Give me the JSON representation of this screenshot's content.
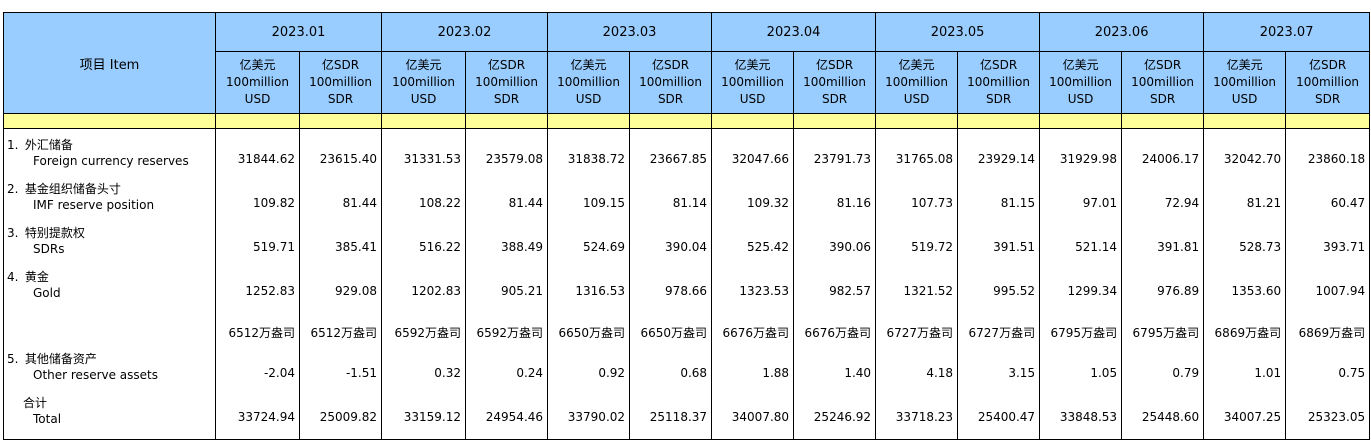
{
  "header": {
    "item_label": "项目 Item",
    "periods": [
      "2023.01",
      "2023.02",
      "2023.03",
      "2023.04",
      "2023.05",
      "2023.06",
      "2023.07"
    ],
    "units": {
      "usd": {
        "zh": "亿美元",
        "en1": "100million",
        "en2": "USD"
      },
      "sdr": {
        "zh": "亿SDR",
        "en1": "100million",
        "en2": "SDR"
      }
    }
  },
  "rows": [
    {
      "num": "1.",
      "zh": "外汇储备",
      "en": "Foreign currency reserves",
      "values": [
        "31844.62",
        "23615.40",
        "31331.53",
        "23579.08",
        "31838.72",
        "23667.85",
        "32047.66",
        "23791.73",
        "31765.08",
        "23929.14",
        "31929.98",
        "24006.17",
        "32042.70",
        "23860.18"
      ]
    },
    {
      "num": "2.",
      "zh": "基金组织储备头寸",
      "en": "IMF reserve position",
      "values": [
        "109.82",
        "81.44",
        "108.22",
        "81.44",
        "109.15",
        "81.14",
        "109.32",
        "81.16",
        "107.73",
        "81.15",
        "97.01",
        "72.94",
        "81.21",
        "60.47"
      ]
    },
    {
      "num": "3.",
      "zh": "特别提款权",
      "en": "SDRs",
      "values": [
        "519.71",
        "385.41",
        "516.22",
        "388.49",
        "524.69",
        "390.04",
        "525.42",
        "390.06",
        "519.72",
        "391.51",
        "521.14",
        "391.81",
        "528.73",
        "393.71"
      ]
    },
    {
      "num": "4.",
      "zh": "黄金",
      "en": "Gold",
      "values": [
        "1252.83",
        "929.08",
        "1202.83",
        "905.21",
        "1316.53",
        "978.66",
        "1323.53",
        "982.57",
        "1321.52",
        "995.52",
        "1299.34",
        "976.89",
        "1353.60",
        "1007.94"
      ]
    }
  ],
  "gold_ounces": [
    "6512万盎司",
    "6512万盎司",
    "6592万盎司",
    "6592万盎司",
    "6650万盎司",
    "6650万盎司",
    "6676万盎司",
    "6676万盎司",
    "6727万盎司",
    "6727万盎司",
    "6795万盎司",
    "6795万盎司",
    "6869万盎司",
    "6869万盎司"
  ],
  "other": {
    "num": "5.",
    "zh": "其他储备资产",
    "en": "Other reserve assets",
    "values": [
      "-2.04",
      "-1.51",
      "0.32",
      "0.24",
      "0.92",
      "0.68",
      "1.88",
      "1.40",
      "4.18",
      "3.15",
      "1.05",
      "0.79",
      "1.01",
      "0.75"
    ]
  },
  "total": {
    "zh": "合计",
    "en": "Total",
    "values": [
      "33724.94",
      "25009.82",
      "33159.12",
      "24954.46",
      "33790.02",
      "25118.37",
      "34007.80",
      "25246.92",
      "33718.23",
      "25400.47",
      "33848.53",
      "25448.60",
      "34007.25",
      "25323.05"
    ]
  },
  "colors": {
    "header_bg": "#99ccff",
    "strip_bg": "#ffff99"
  }
}
